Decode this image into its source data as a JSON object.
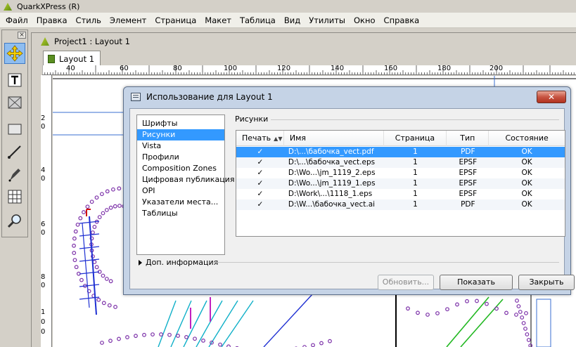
{
  "app": {
    "title": "QuarkXPress (R)"
  },
  "menu": [
    "Файл",
    "Правка",
    "Стиль",
    "Элемент",
    "Страница",
    "Макет",
    "Таблица",
    "Вид",
    "Утилиты",
    "Окно",
    "Справка"
  ],
  "tools": {
    "close_glyph": "×",
    "icons": [
      "move-tool-icon",
      "text-tool-icon",
      "picture-box-tool-icon",
      "rectangle-tool-icon",
      "line-tool-icon",
      "pen-tool-icon",
      "table-tool-icon",
      "zoom-tool-icon"
    ]
  },
  "document": {
    "title": "Project1 : Layout 1",
    "tab": "Layout 1",
    "ruler_top": [
      "40",
      "60",
      "80",
      "100",
      "120",
      "140",
      "160",
      "180",
      "200"
    ],
    "ruler_left": [
      "2",
      "0",
      "4",
      "0",
      "6",
      "0",
      "8",
      "0",
      "1",
      "0",
      "0"
    ]
  },
  "dialog": {
    "title": "Использование для Layout 1",
    "close_glyph": "✕",
    "categories": [
      "Шрифты",
      "Рисунки",
      "Vista",
      "Профили",
      "Composition Zones",
      "Цифровая публикация",
      "OPI",
      "Указатели места...",
      "Таблицы"
    ],
    "selected_category": 1,
    "section_label": "Рисунки",
    "more_info": "Доп. информация",
    "columns": {
      "print": "Печать",
      "name": "Имя",
      "page": "Страница",
      "type": "Тип",
      "state": "Состояние"
    },
    "rows": [
      {
        "print": "✓",
        "name": "D:\\...\\бабочка_vect.pdf",
        "page": "1",
        "type": "PDF",
        "state": "OK"
      },
      {
        "print": "✓",
        "name": "D:\\...\\бабочка_vect.eps",
        "page": "1",
        "type": "EPSF",
        "state": "OK"
      },
      {
        "print": "✓",
        "name": "D:\\Wo...\\jm_1119_2.eps",
        "page": "1",
        "type": "EPSF",
        "state": "OK"
      },
      {
        "print": "✓",
        "name": "D:\\Wo...\\jm_1119_1.eps",
        "page": "1",
        "type": "EPSF",
        "state": "OK"
      },
      {
        "print": "✓",
        "name": "D:\\Work\\...\\1118_1.eps",
        "page": "1",
        "type": "EPSF",
        "state": "OK"
      },
      {
        "print": "✓",
        "name": "D:\\W...\\бабочка_vect.ai",
        "page": "1",
        "type": "PDF",
        "state": "OK"
      }
    ],
    "selected_row": 0,
    "buttons": {
      "update": "Обновить...",
      "show": "Показать",
      "close": "Закрыть"
    }
  },
  "colors": {
    "selection": "#3399ff",
    "dialog_frame": "#c5d3e6",
    "close_button": "#c75543"
  }
}
